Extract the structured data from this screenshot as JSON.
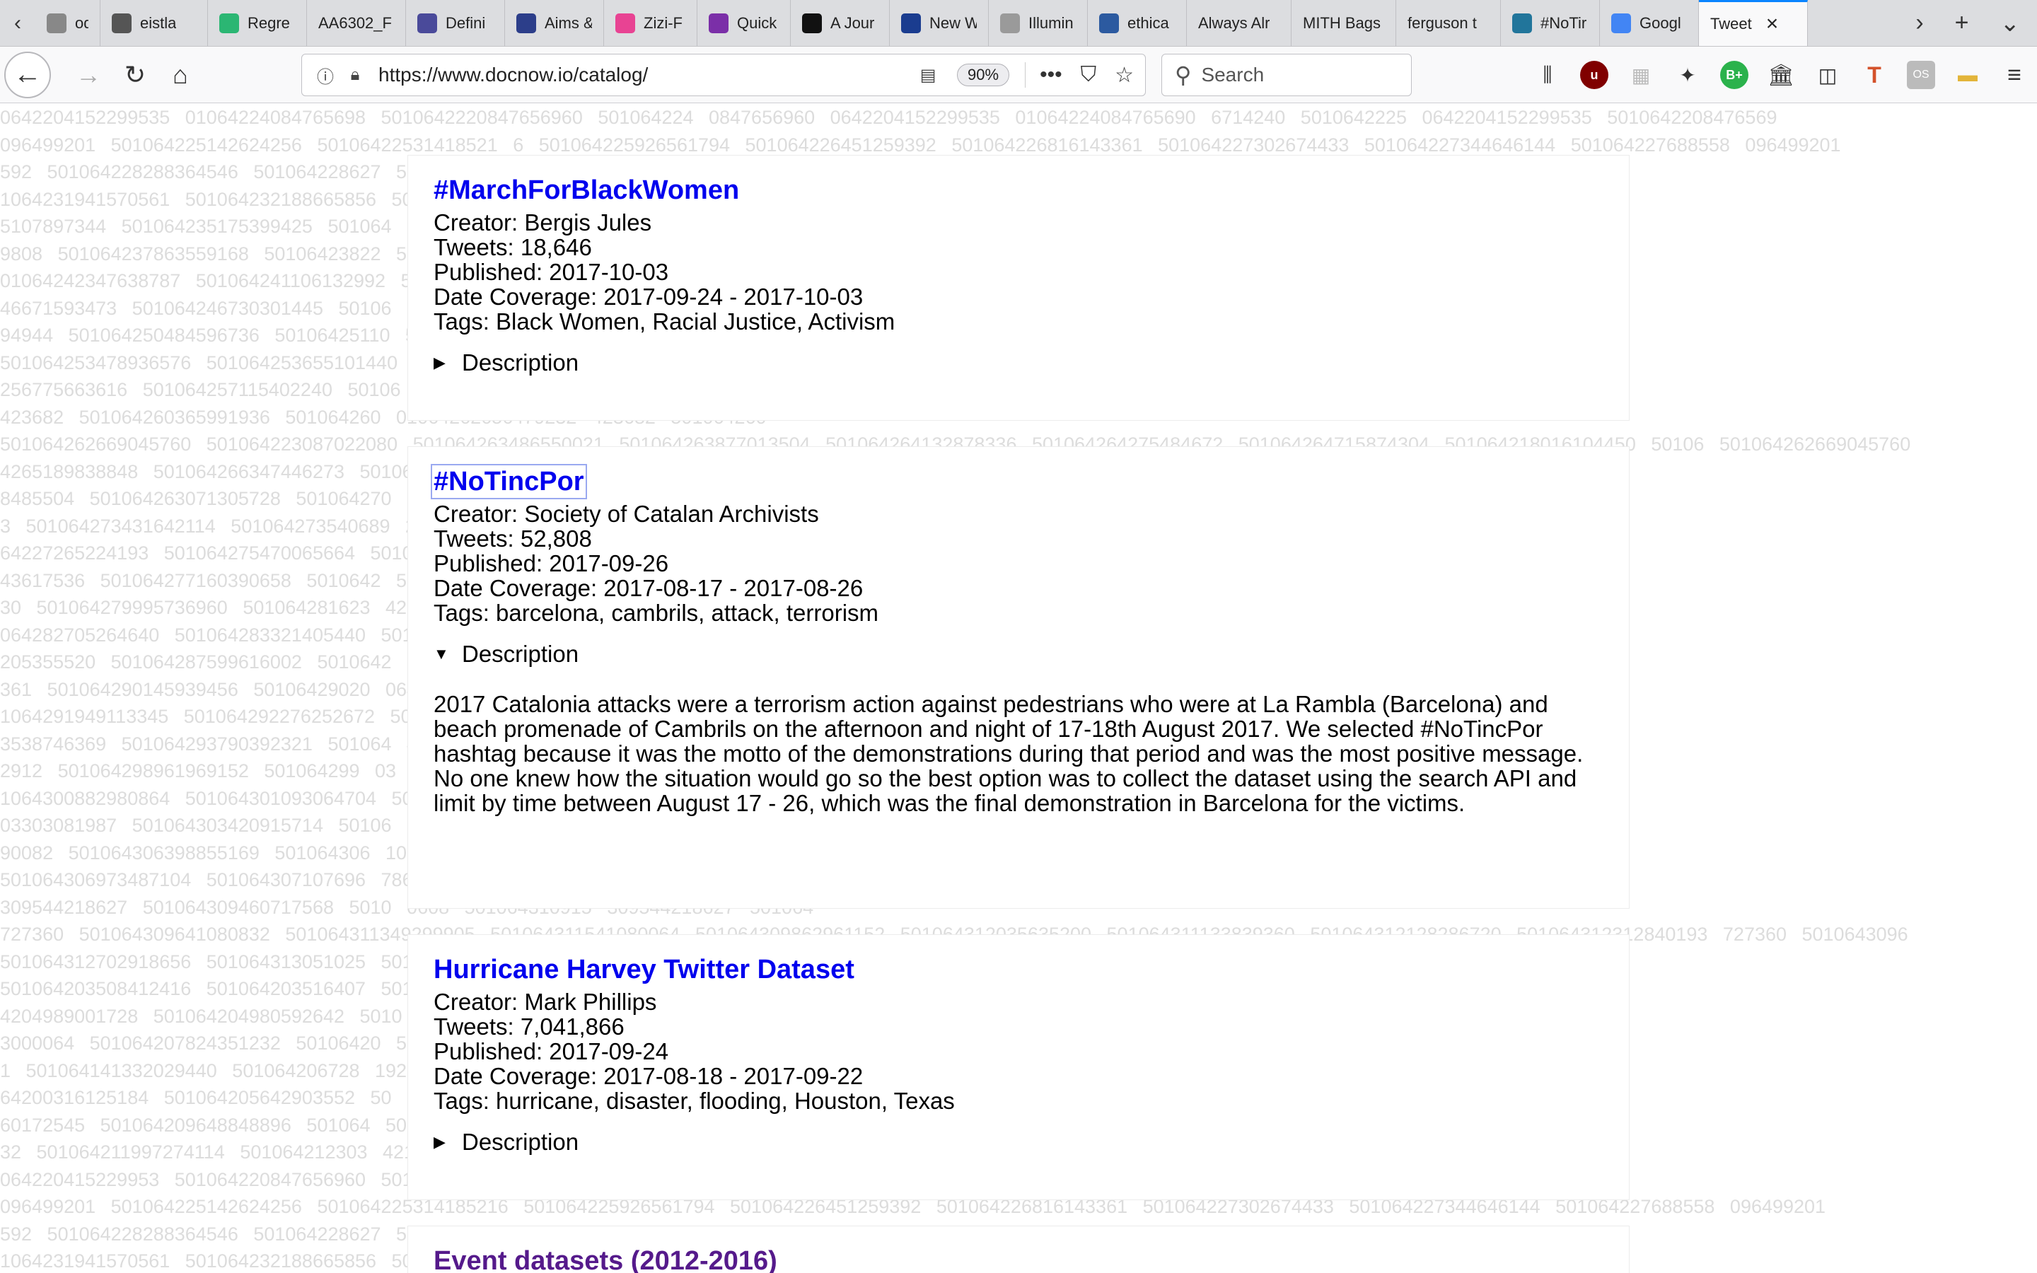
{
  "browser": {
    "tabs": [
      {
        "label": "ods",
        "icon": "generic-page-icon",
        "color": "#888888"
      },
      {
        "label": "eistla",
        "icon": "image-favicon-icon",
        "color": "#555555"
      },
      {
        "label": "Regre",
        "icon": "green-shield-icon",
        "color": "#2bb673"
      },
      {
        "label": "AA6302_F",
        "icon": "",
        "color": "#ffffff"
      },
      {
        "label": "Defini",
        "icon": "doc-favicon-icon",
        "color": "#4a4a9a"
      },
      {
        "label": "Aims &",
        "icon": "crown-favicon-icon",
        "color": "#2c3e8a"
      },
      {
        "label": "Zizi-F",
        "icon": "rainbow-favicon-icon",
        "color": "#e84393"
      },
      {
        "label": "Quick",
        "icon": "circle-favicon-icon",
        "color": "#7b2fa8"
      },
      {
        "label": "A Jour",
        "icon": "nyt-favicon-icon",
        "color": "#111111"
      },
      {
        "label": "New W",
        "icon": "round-blue-favicon-icon",
        "color": "#1a3c8f"
      },
      {
        "label": "Illumin",
        "icon": "doc-gray-favicon-icon",
        "color": "#9a9a9a"
      },
      {
        "label": "ethica",
        "icon": "orb-favicon-icon",
        "color": "#2c5aa0"
      },
      {
        "label": "Always Alr",
        "icon": "",
        "color": "#ffffff"
      },
      {
        "label": "MITH Bags",
        "icon": "",
        "color": "#ffffff"
      },
      {
        "label": "ferguson t",
        "icon": "",
        "color": "#ffffff"
      },
      {
        "label": "#NoTir",
        "icon": "wordpress-favicon-icon",
        "color": "#21759b"
      },
      {
        "label": "Googl",
        "icon": "translate-favicon-icon",
        "color": "#4285f4"
      },
      {
        "label": "Tweet",
        "icon": "",
        "color": "#ffffff",
        "active": true
      }
    ],
    "url": "https://www.docnow.io/catalog/",
    "zoom": "90%",
    "search_placeholder": "Search"
  },
  "catalog": {
    "description_label": "Description",
    "cards": [
      {
        "title": "#MarchForBlackWomen",
        "creator": "Creator: Bergis Jules",
        "tweets": "Tweets: 18,646",
        "published": "Published: 2017-10-03",
        "coverage": "Date Coverage: 2017-09-24 - 2017-10-03",
        "tags": "Tags: Black Women, Racial Justice, Activism",
        "expanded": false
      },
      {
        "title": "#NoTincPor",
        "creator": "Creator: Society of Catalan Archivists",
        "tweets": "Tweets: 52,808",
        "published": "Published: 2017-09-26",
        "coverage": "Date Coverage: 2017-08-17 - 2017-08-26",
        "tags": "Tags: barcelona, cambrils, attack, terrorism",
        "expanded": true,
        "description": "2017 Catalonia attacks were a terrorism action against pedestrians who were at La Rambla (Barcelona) and beach promenade of Cambrils on the afternoon and night of 17-18th August 2017. We selected #NoTincPor hashtag because it was the motto of the demonstrations during that period and was the most positive message. No one knew how the situation would go so the best option was to collect the dataset using the search API and limit by time between August 17 - 26, which was the final demonstration in Barcelona for the victims."
      },
      {
        "title": "Hurricane Harvey Twitter Dataset",
        "creator": "Creator: Mark Phillips",
        "tweets": "Tweets: 7,041,866",
        "published": "Published: 2017-09-24",
        "coverage": "Date Coverage: 2017-08-18 - 2017-09-22",
        "tags": "Tags: hurricane, disaster, flooding, Houston, Texas",
        "expanded": false
      },
      {
        "title": "Event datasets (2012-2016)"
      }
    ]
  },
  "background_numbers": [
    "0642204152299535 01064224084765698 5010642220847656960 501064224 0847656960 0642204152299535 01064224084765690 6714240 5010642225 0642204152299535 5010642208476569",
    "096499201 501064225142624256 50106422531418521 6 501064225926561794 501064226451259392 501064226816143361 501064227302674433 501064227344646144 501064227688558 096499201",
    "592 501064228288364546 501064228627 501064228895 501064229 501064230 501064231 50106423148 50106423148820070 4 50 592 501064228288364546",
    "1064231941570561 501064232188665856 5010 5010642 50106 501064 501064 501064 501064 74510081 50106423 1064231941570561 5010",
    "5107897344 501064235175399425 501064 501064 501064 5010 50106 5010 5010642 52 501064237339 63 5107897344 501064",
    "9808 501064237863559168 50106423822 5010 50106 5010 5010 501064 064240267288577 5 9808 501064237863",
    "01064242347638787 501064241106132992 5010 5010 50106 50106 5010 525186048 5010642 01064242347638787 501064",
    "46671593473 501064246730301445 50106 5010 5010 5010 104 50106421631 73 46671593473 50106",
    "94944 501064250484596736 50106425110 5010 5010 50106421786092 3392 94944 501064250484",
    "501064253478936576 501064253655101440 5010 5010 6763473920 501064 501064253478936576",
    "256775663616 501064257115402240 50106 1409 501064259460 256775663616 501064",
    "423682 501064260365991936 501064260 01064262656479232 423682 501064260",
    "501064262669045760 501064223087022080 501064263486550021 501064263877013504 501064264132878336 501064264275484672 501064264715874304 501064218016104450 50106 501064262669045760",
    "4265189838848 501064266347446273 50106 72992 501064266839 4265189838848 501064",
    "8485504 501064263071305728 501064270 5010642730327736 3 8485504 5010642630",
    "3 501064273431642114 501064273540689 275348455424 5010 3 501064273431642",
    "64227265224193 501064275470065664 50106 767936 501064277 1 64227265224193 501",
    "43617536 501064277160390658 5010642 501064279639216 1 43617536 501064277",
    "30 501064279995736960 501064281623 4282562650112 501 30 501064279995736",
    "064282705264640 501064283321405440 5010 1777664 50106428 7 064282705264640",
    "205355520 501064287599616002 5010642 0 501064290145935 205355520 5010642",
    "361 501064290145939456 50106429020 064291492311041 50 361 501064290145",
    "1064291949113345 501064292276252672 5010 46669824 5010642 9 1064291949113345",
    "3538746369 501064293790392321 501064 40 501064297666 34 3538746369 501064",
    "2912 501064298961969152 501064299 03 064300782710784 5 2912 5010642989619",
    "1064300882980864 501064301093064704 5010 652952577 5010643 01064300882980864",
    "03303081987 501064303420915714 50106 657 501064302736157 03303081987 5010",
    "90082 501064306398855169 501064306 1064306965086208 90082 501064306398",
    "501064306973487104 501064307107696 7866886144 501064 501064306973487104",
    "309544218627 501064309460717568 5010 0608 501064310915 309544218627 501064",
    "727360 501064309641080832 501064311349299905 501064311541080064 501064309862961152 501064312035635200 501064311133839360 501064312128286720 501064312312840193 727360 5010643096",
    "501064312702918656 501064313051025 5010 15286605826 50106 501064312702918656",
    "501064203508412416 501064203516407 5010 94309906436 50106 501064203508412",
    "4204989001728 501064204980592642 5010 96576 501064207 62 4204989001728 5010642",
    "3000064 501064207824351232 50106420 5010642095519 9488 3000064 50106420782",
    "1 501064141332029440 501064206728 192024006657 5010 1 50106414133202944",
    "64200316125184 501064205642903552 50 731457 501064215 1 64200316125184 5010",
    "60172545 501064209648848896 501064 501064216767960 8 60172545 5010642096",
    "32 501064211997274114 501064212303 42100804730 88 501 32 501064211997274",
    "064220415229953 501064220847656960 5010 6714240 501064225 064220415229953",
    "096499201 501064225142624256 501064225314185216 501064225926561794 501064226451259392 501064226816143361 501064227302674433 501064227344646144 501064227688558 096499201",
    "592 501064228288364546 501064228627 501064228 50106 50106 5010642314882007 4 50 592 5010642282883645",
    "1064231941570561 501064232188665856 5010 74510081 5010642 1064231941570561 5010642"
  ]
}
